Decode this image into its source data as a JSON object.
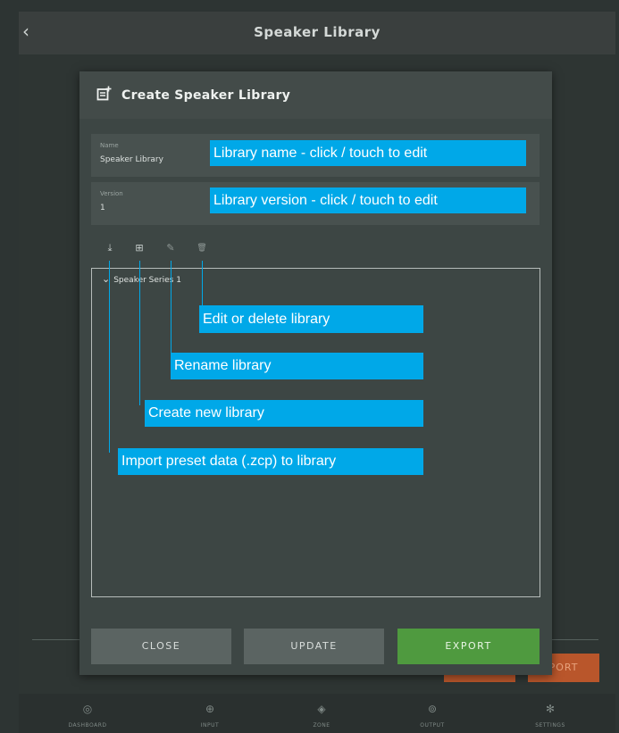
{
  "app": {
    "back_glyph": "‹",
    "title": "Speaker Library"
  },
  "background": {
    "buttons": [
      "",
      "PORT"
    ]
  },
  "bottom_nav": [
    {
      "label": "DASHBOARD",
      "icon": "dashboard-icon",
      "glyph": "◎"
    },
    {
      "label": "INPUT",
      "icon": "input-icon",
      "glyph": "⊕"
    },
    {
      "label": "ZONE",
      "icon": "zone-icon",
      "glyph": "◈"
    },
    {
      "label": "OUTPUT",
      "icon": "output-icon",
      "glyph": "⊚"
    },
    {
      "label": "SETTINGS",
      "icon": "settings-icon",
      "glyph": "✻"
    }
  ],
  "dialog": {
    "title": "Create Speaker Library",
    "name_field": {
      "label": "Name",
      "value": "Speaker Library"
    },
    "version_field": {
      "label": "Version",
      "value": "1"
    },
    "toolbar": [
      {
        "name": "import-icon",
        "glyph": "⤓"
      },
      {
        "name": "new-library-icon",
        "glyph": "⊞"
      },
      {
        "name": "rename-icon",
        "glyph": "✎"
      },
      {
        "name": "delete-icon",
        "glyph": "🗑"
      }
    ],
    "tree": {
      "caret": "⌄",
      "node_label": "Speaker Series 1"
    },
    "buttons": {
      "close": "CLOSE",
      "update": "UPDATE",
      "export": "EXPORT"
    }
  },
  "callouts": {
    "name": "Library name - click / touch to edit",
    "version": "Library version - click / touch to edit",
    "edit_delete": "Edit or delete library",
    "rename": "Rename library",
    "create": "Create new library",
    "import": "Import preset data (.zcp) to library"
  },
  "colors": {
    "accent_callout": "#00a8e8",
    "export_button": "#4f9a3f",
    "background_orange": "#b9562b",
    "modal": "#3d4644"
  }
}
